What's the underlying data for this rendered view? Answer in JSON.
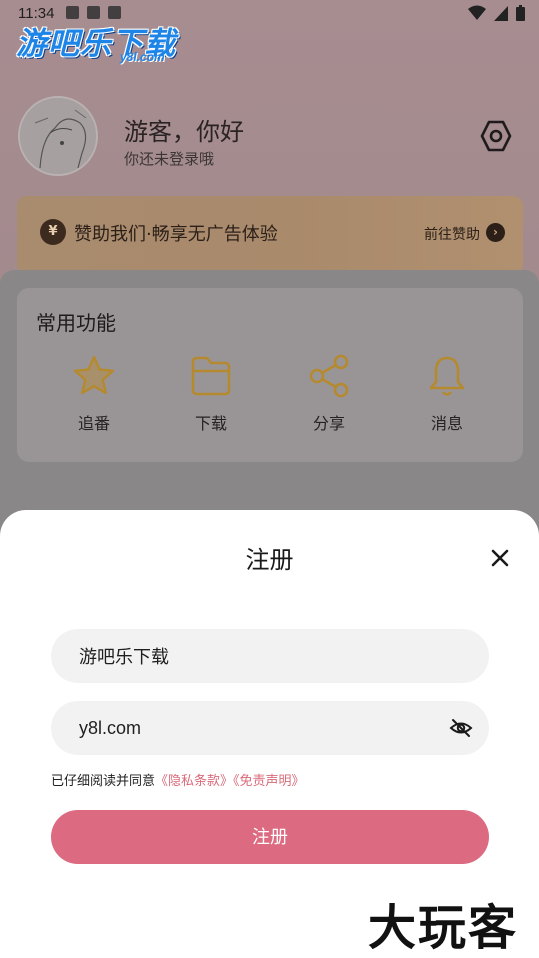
{
  "status_bar": {
    "time": "11:34"
  },
  "watermark_top": {
    "title": "游吧乐下载",
    "subtitle": "y8l.com"
  },
  "profile": {
    "greeting": "游客，你好",
    "subtext": "你还未登录哦"
  },
  "sponsor": {
    "coin": "¥",
    "text": "赞助我们·畅享无广告体验",
    "link": "前往赞助"
  },
  "functions": {
    "title": "常用功能",
    "items": [
      {
        "label": "追番",
        "icon": "star-icon"
      },
      {
        "label": "下载",
        "icon": "folder-icon"
      },
      {
        "label": "分享",
        "icon": "share-icon"
      },
      {
        "label": "消息",
        "icon": "bell-icon"
      }
    ]
  },
  "register_sheet": {
    "title": "注册",
    "username_value": "游吧乐下载",
    "password_value": "y8l.com",
    "agree_prefix": "已仔细阅读并同意",
    "privacy_link": "《隐私条款》",
    "disclaimer_link": "《免责声明》",
    "submit_label": "注册"
  },
  "brand_watermark": "大玩客",
  "colors": {
    "accent": "#dc6a80",
    "link": "#d96b7a",
    "icon_gold": "#b58a2e"
  }
}
